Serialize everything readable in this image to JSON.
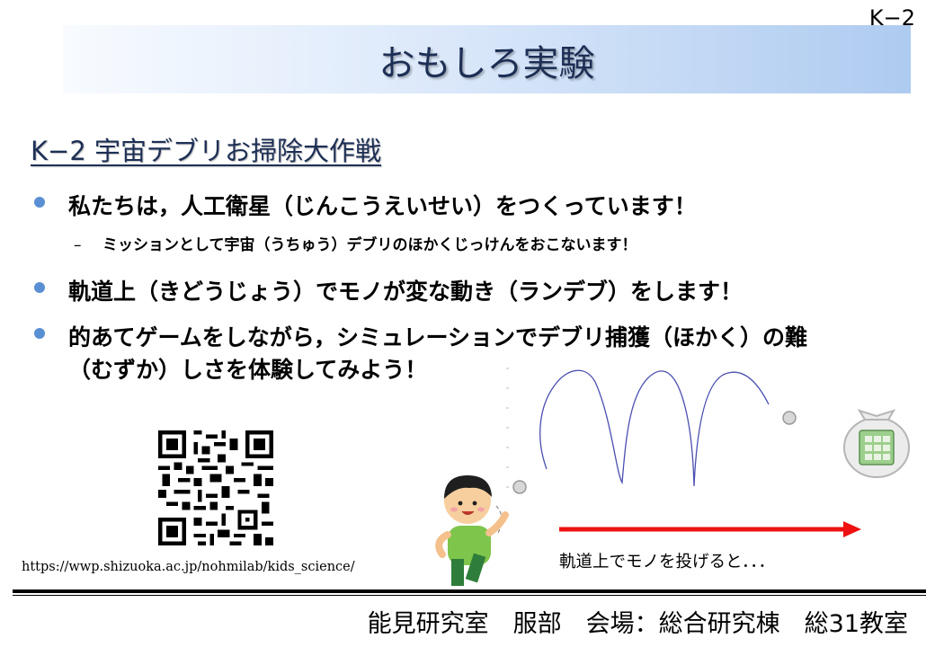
{
  "slide_id": "K−2",
  "title": "おもしろ実験",
  "subtitle": "K−2 宇宙デブリお掃除大作戦",
  "bullets": [
    {
      "text": "私たちは，人工衛星（じんこうえいせい）をつくっています！"
    },
    {
      "text": "軌道上（きどうじょう）でモノが変な動き（ランデブ）をします！"
    },
    {
      "line1": "的あてゲームをしながら，シミュレーションでデブリ捕獲（ほかく）の難",
      "line2": "（むずか）しさを体験してみよう！"
    }
  ],
  "sub_bullet": {
    "dash": "–",
    "text": "ミッションとして宇宙（うちゅう）デブリのほかくじっけんをおこないます！"
  },
  "qr_icon": "qr-code-icon",
  "url": "https://wwp.shizuoka.ac.jp/nohmilab/kids_science/",
  "caption": "軌道上でモノを投げると．．．",
  "footer": "能見研究室　服部　会場：総合研究棟　総31教室",
  "colors": {
    "title_band_start": "#f8fbff",
    "title_band_end": "#aecbf0",
    "title_text": "#1d2f55",
    "bullet_dot": "#5b8fd3",
    "arrow": "#ee1111",
    "trajectory": "#4a4fb0"
  }
}
